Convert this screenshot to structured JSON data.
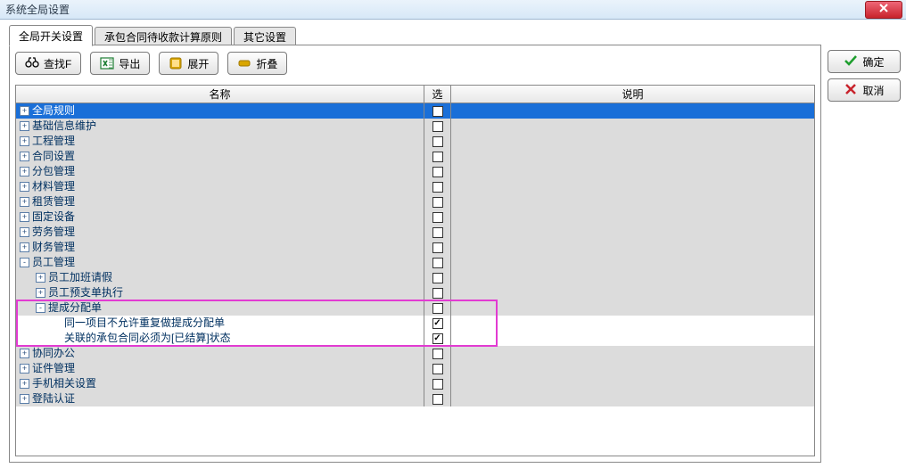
{
  "window": {
    "title": "系统全局设置"
  },
  "tabs": [
    {
      "label": "全局开关设置",
      "active": true
    },
    {
      "label": "承包合同待收款计算原则",
      "active": false
    },
    {
      "label": "其它设置",
      "active": false
    }
  ],
  "toolbar": {
    "search": "查找F",
    "export": "导出",
    "expand": "展开",
    "collapse": "折叠"
  },
  "grid": {
    "headers": {
      "name": "名称",
      "sel": "选",
      "desc": "说明"
    },
    "rows": [
      {
        "level": 0,
        "toggler": "+",
        "label": "全局规则",
        "checked": false,
        "selected": true,
        "white": false
      },
      {
        "level": 0,
        "toggler": "+",
        "label": "基础信息维护",
        "checked": false,
        "white": false
      },
      {
        "level": 0,
        "toggler": "+",
        "label": "工程管理",
        "checked": false,
        "white": false
      },
      {
        "level": 0,
        "toggler": "+",
        "label": "合同设置",
        "checked": false,
        "white": false
      },
      {
        "level": 0,
        "toggler": "+",
        "label": "分包管理",
        "checked": false,
        "white": false
      },
      {
        "level": 0,
        "toggler": "+",
        "label": "材料管理",
        "checked": false,
        "white": false
      },
      {
        "level": 0,
        "toggler": "+",
        "label": "租赁管理",
        "checked": false,
        "white": false
      },
      {
        "level": 0,
        "toggler": "+",
        "label": "固定设备",
        "checked": false,
        "white": false
      },
      {
        "level": 0,
        "toggler": "+",
        "label": "劳务管理",
        "checked": false,
        "white": false
      },
      {
        "level": 0,
        "toggler": "+",
        "label": "财务管理",
        "checked": false,
        "white": false
      },
      {
        "level": 0,
        "toggler": "-",
        "label": "员工管理",
        "checked": false,
        "white": false
      },
      {
        "level": 1,
        "toggler": "+",
        "label": "员工加班请假",
        "checked": false,
        "white": false
      },
      {
        "level": 1,
        "toggler": "+",
        "label": "员工预支单执行",
        "checked": false,
        "white": false
      },
      {
        "level": 1,
        "toggler": "-",
        "label": "提成分配单",
        "checked": false,
        "white": false
      },
      {
        "level": 2,
        "toggler": "",
        "label": "同一项目不允许重复做提成分配单",
        "checked": true,
        "white": true
      },
      {
        "level": 2,
        "toggler": "",
        "label": "关联的承包合同必须为[已结算]状态",
        "checked": true,
        "white": true
      },
      {
        "level": 0,
        "toggler": "+",
        "label": "协同办公",
        "checked": false,
        "white": false
      },
      {
        "level": 0,
        "toggler": "+",
        "label": "证件管理",
        "checked": false,
        "white": false
      },
      {
        "level": 0,
        "toggler": "+",
        "label": "手机相关设置",
        "checked": false,
        "white": false
      },
      {
        "level": 0,
        "toggler": "+",
        "label": "登陆认证",
        "checked": false,
        "white": false
      }
    ],
    "highlight": {
      "top_row": 13,
      "bottom_row": 15
    }
  },
  "right": {
    "ok": "确定",
    "cancel": "取消"
  }
}
